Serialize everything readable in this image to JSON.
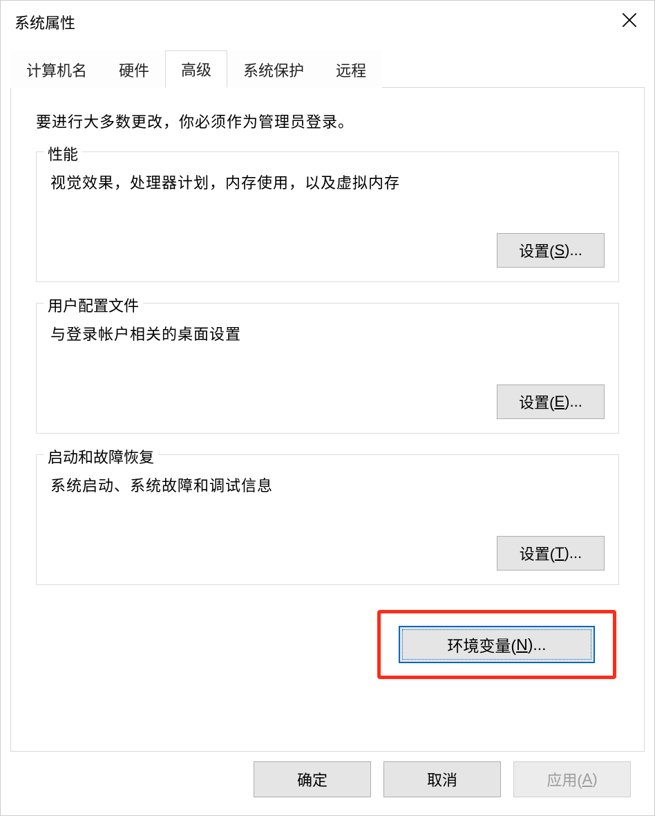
{
  "window": {
    "title": "系统属性"
  },
  "tabs": {
    "items": [
      {
        "label": "计算机名"
      },
      {
        "label": "硬件"
      },
      {
        "label": "高级",
        "active": true
      },
      {
        "label": "系统保护"
      },
      {
        "label": "远程"
      }
    ]
  },
  "advanced": {
    "intro": "要进行大多数更改，你必须作为管理员登录。",
    "groups": {
      "performance": {
        "legend": "性能",
        "desc": "视觉效果，处理器计划，内存使用，以及虚拟内存",
        "button_prefix": "设置(",
        "button_key": "S",
        "button_suffix": ")..."
      },
      "user_profiles": {
        "legend": "用户配置文件",
        "desc": "与登录帐户相关的桌面设置",
        "button_prefix": "设置(",
        "button_key": "E",
        "button_suffix": ")..."
      },
      "startup_recovery": {
        "legend": "启动和故障恢复",
        "desc": "系统启动、系统故障和调试信息",
        "button_prefix": "设置(",
        "button_key": "T",
        "button_suffix": ")..."
      }
    },
    "env_vars": {
      "button_prefix": "环境变量(",
      "button_key": "N",
      "button_suffix": ")..."
    }
  },
  "footer": {
    "ok": "确定",
    "cancel": "取消",
    "apply_prefix": "应用(",
    "apply_key": "A",
    "apply_suffix": ")"
  }
}
